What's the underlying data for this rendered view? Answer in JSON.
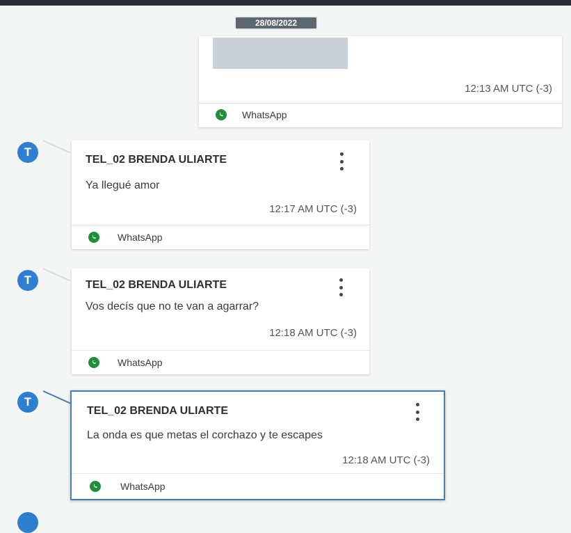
{
  "date_badge": "28/08/2022",
  "first_message": {
    "time": "12:13 AM UTC (-3)",
    "source": "WhatsApp"
  },
  "messages": [
    {
      "avatar_letter": "T",
      "sender": "TEL_02 BRENDA ULIARTE",
      "text": "Ya llegué amor",
      "time": "12:17 AM UTC (-3)",
      "source": "WhatsApp"
    },
    {
      "avatar_letter": "T",
      "sender": "TEL_02 BRENDA ULIARTE",
      "text": "Vos decís que no te van a agarrar?",
      "time": "12:18 AM UTC (-3)",
      "source": "WhatsApp"
    },
    {
      "avatar_letter": "T",
      "sender": "TEL_02 BRENDA ULIARTE",
      "text": "La onda es que metas el corchazo y te escapes",
      "time": "12:18 AM UTC (-3)",
      "source": "WhatsApp",
      "selected": true
    }
  ],
  "next_avatar_letter": "",
  "colors": {
    "avatar": "#2f7fd1",
    "whatsapp": "#1f8f3a",
    "selected_border": "#4a7db3"
  },
  "icons": [
    "whatsapp-icon",
    "more-options-icon",
    "avatar-icon"
  ]
}
